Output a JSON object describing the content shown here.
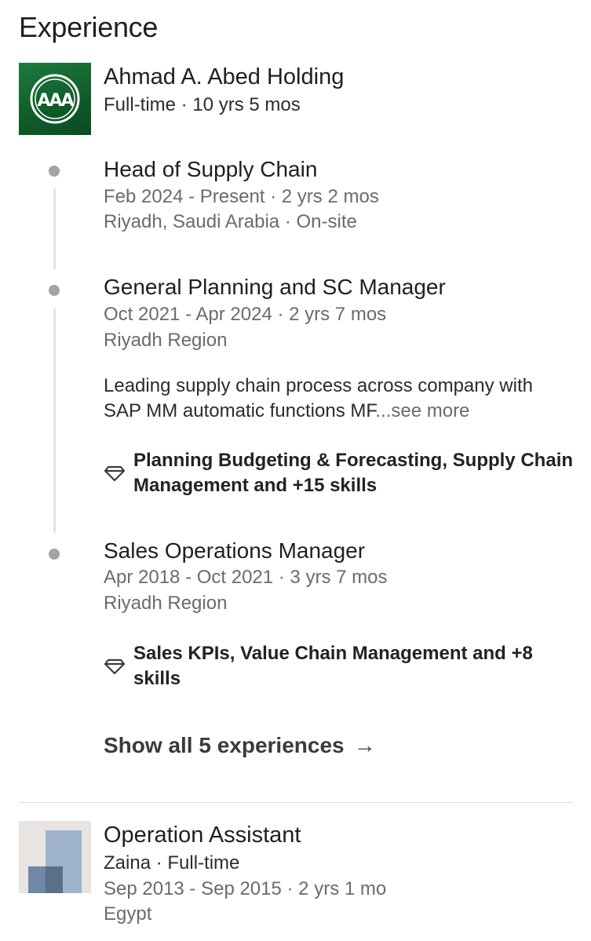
{
  "section": {
    "title": "Experience"
  },
  "company": {
    "logo_text": "AAA",
    "name": "Ahmad A. Abed Holding",
    "meta": "Full-time · 10 yrs 5 mos",
    "logo_color": "#0f5c2a"
  },
  "roles": [
    {
      "title": "Head of Supply Chain",
      "dates": "Feb 2024 - Present · 2 yrs 2 mos",
      "location": "Riyadh, Saudi Arabia · On-site"
    },
    {
      "title": "General Planning and SC Manager",
      "dates": "Oct 2021 - Apr 2024 · 2 yrs 7 mos",
      "location": "Riyadh Region",
      "description": "Leading supply chain process across company with SAP MM automatic functions MF",
      "see_more": "...see more",
      "skills": "Planning Budgeting & Forecasting, Supply Chain Management and +15 skills"
    },
    {
      "title": "Sales Operations Manager",
      "dates": "Apr 2018 - Oct 2021 · 3 yrs 7 mos",
      "location": "Riyadh Region",
      "skills": "Sales KPIs, Value Chain Management and +8 skills"
    }
  ],
  "show_all": {
    "label": "Show all 5 experiences",
    "arrow": "→"
  },
  "next_experience": {
    "title": "Operation Assistant",
    "company": "Zaina · Full-time",
    "dates": "Sep 2013 - Sep 2015 · 2 yrs 1 mo",
    "location": "Egypt"
  },
  "icons": {
    "skill": "diamond-icon",
    "arrow": "arrow-right-icon"
  },
  "colors": {
    "timeline_dot": "#a3a3a3",
    "muted_text": "#6b6b6b"
  }
}
